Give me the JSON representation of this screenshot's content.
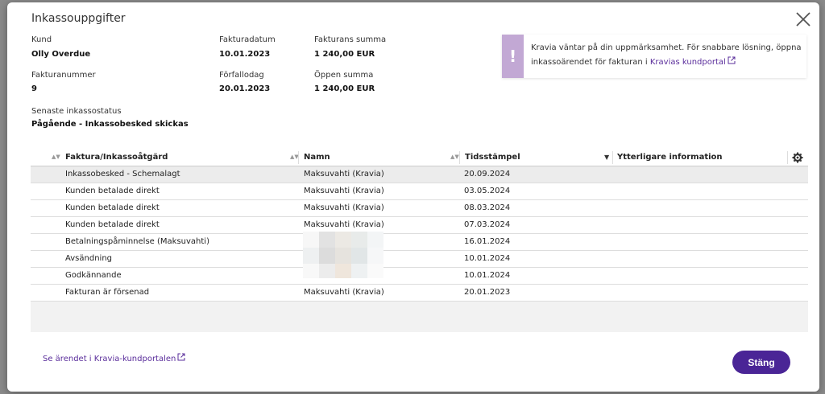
{
  "dialog": {
    "title": "Inkassouppgifter",
    "close_icon": "close-icon"
  },
  "details": {
    "kund_label": "Kund",
    "kund_value": "Olly Overdue",
    "fakturadatum_label": "Fakturadatum",
    "fakturadatum_value": "10.01.2023",
    "summa_label": "Fakturans summa",
    "summa_value": "1 240,00 EUR",
    "fakturanummer_label": "Fakturanummer",
    "fakturanummer_value": "9",
    "forfallodag_label": "Förfallodag",
    "forfallodag_value": "20.01.2023",
    "oppen_label": "Öppen summa",
    "oppen_value": "1 240,00 EUR",
    "status_label": "Senaste inkassostatus",
    "status_value": "Pågående - Inkassobesked skickas"
  },
  "notice": {
    "icon": "!",
    "text": "Kravia väntar på din uppmärksamhet. För snabbare lösning, öppna inkassoärendet för fakturan i ",
    "link": "Kravias kundportal",
    "bar_color": "#c2a8d4"
  },
  "table": {
    "columns": [
      "Faktura/Inkassoåtgärd",
      "Namn",
      "Tidsstämpel",
      "Ytterligare information"
    ],
    "rows": [
      {
        "action": "Inkassobesked - Schemalagt",
        "name": "Maksuvahti (Kravia)",
        "timestamp": "20.09.2024",
        "info": ""
      },
      {
        "action": "Kunden betalade direkt",
        "name": "Maksuvahti (Kravia)",
        "timestamp": "03.05.2024",
        "info": ""
      },
      {
        "action": "Kunden betalade direkt",
        "name": "Maksuvahti (Kravia)",
        "timestamp": "08.03.2024",
        "info": ""
      },
      {
        "action": "Kunden betalade direkt",
        "name": "Maksuvahti (Kravia)",
        "timestamp": "07.03.2024",
        "info": ""
      },
      {
        "action": "Betalningspåminnelse (Maksuvahti)",
        "name": "",
        "timestamp": "16.01.2024",
        "info": ""
      },
      {
        "action": "Avsändning",
        "name": "",
        "timestamp": "10.01.2024",
        "info": ""
      },
      {
        "action": "Godkännande",
        "name": "",
        "timestamp": "10.01.2024",
        "info": ""
      },
      {
        "action": "Fakturan är försenad",
        "name": "Maksuvahti (Kravia)",
        "timestamp": "20.01.2023",
        "info": ""
      }
    ]
  },
  "footer": {
    "portal_link": "Se ärendet i Kravia-kundportalen",
    "close_button": "Stäng"
  },
  "colors": {
    "accent": "#4a2596",
    "link": "#5a2d9b"
  }
}
